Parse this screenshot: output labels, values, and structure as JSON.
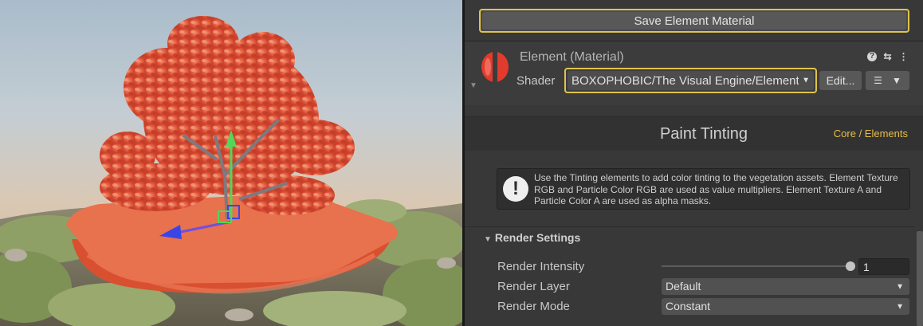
{
  "inspector": {
    "save_button_label": "Save Element Material",
    "material": {
      "title": "Element (Material)",
      "shader_label": "Shader",
      "shader_value": "BOXOPHOBIC/The Visual Engine/Elements/Paint Tinting",
      "edit_label": "Edit...",
      "header_icons": [
        "help-icon",
        "preset-sliders-icon",
        "more-menu-icon"
      ]
    },
    "section": {
      "title": "Paint Tinting",
      "breadcrumb": "Core / Elements"
    },
    "info_message": "Use the Tinting elements to add color tinting to the vegetation assets. Element Texture RGB and Particle Color RGB are used as value multipliers. Element Texture A and Particle Color A are used as alpha masks.",
    "render_settings": {
      "header": "Render Settings",
      "intensity_label": "Render Intensity",
      "intensity_value": "1",
      "intensity_slider_fraction": 1.0,
      "layer_label": "Render Layer",
      "layer_value": "Default",
      "mode_label": "Render Mode",
      "mode_value": "Constant"
    }
  },
  "colors": {
    "highlight_border": "#e0c34a",
    "link": "#e9bd47",
    "leaves": "#e2573a",
    "ground_tile": "#e8714e",
    "gizmo_y": "#53d65a",
    "gizmo_z": "#3a45e8",
    "material_icon": "#e23b2d"
  }
}
